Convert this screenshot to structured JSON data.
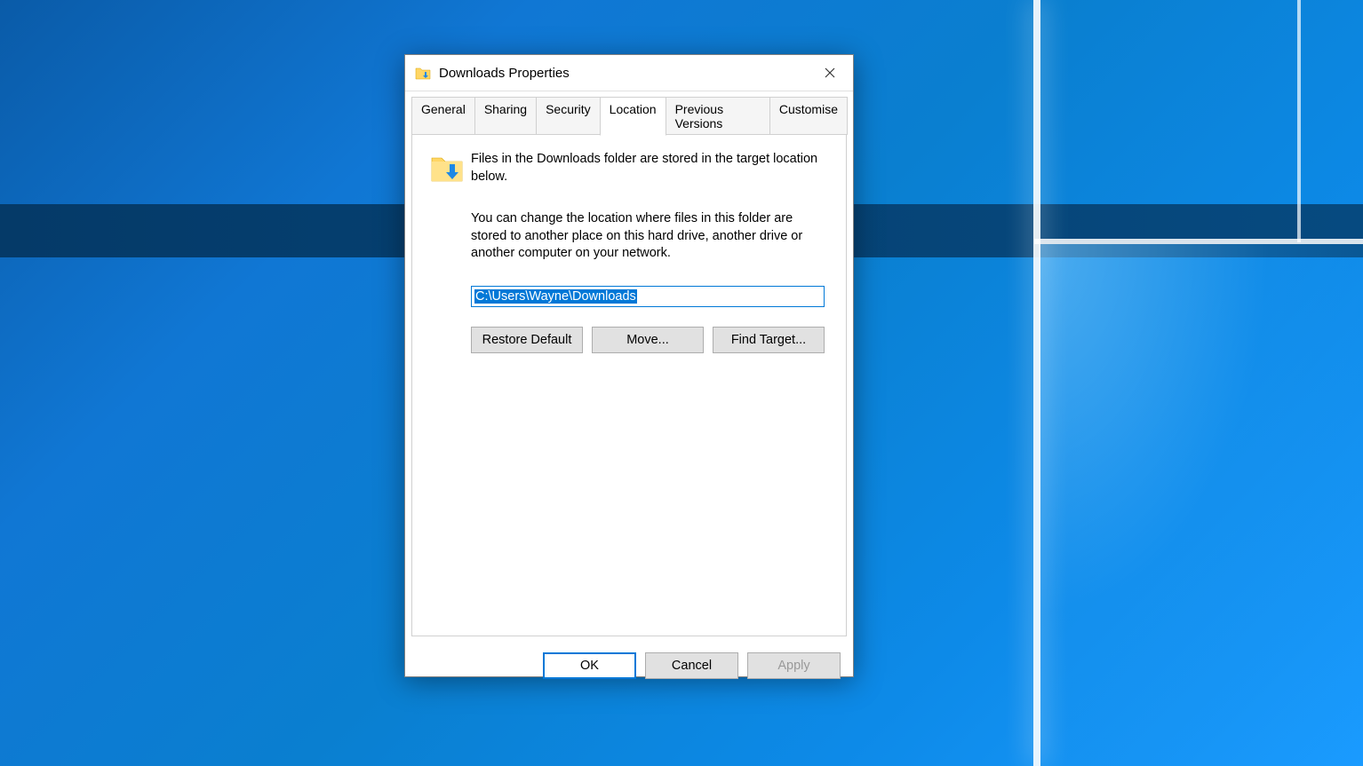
{
  "window": {
    "title": "Downloads Properties"
  },
  "tabs": [
    {
      "label": "General",
      "active": false
    },
    {
      "label": "Sharing",
      "active": false
    },
    {
      "label": "Security",
      "active": false
    },
    {
      "label": "Location",
      "active": true
    },
    {
      "label": "Previous Versions",
      "active": false
    },
    {
      "label": "Customise",
      "active": false
    }
  ],
  "content": {
    "info_text": "Files in the Downloads folder are stored in the target location below.",
    "desc_text": "You can change the location where files in this folder are stored to another place on this hard drive, another drive or another computer on your network.",
    "path_value": "C:\\Users\\Wayne\\Downloads",
    "buttons": {
      "restore": "Restore Default",
      "move": "Move...",
      "find": "Find Target..."
    }
  },
  "dialog_buttons": {
    "ok": "OK",
    "cancel": "Cancel",
    "apply": "Apply"
  }
}
